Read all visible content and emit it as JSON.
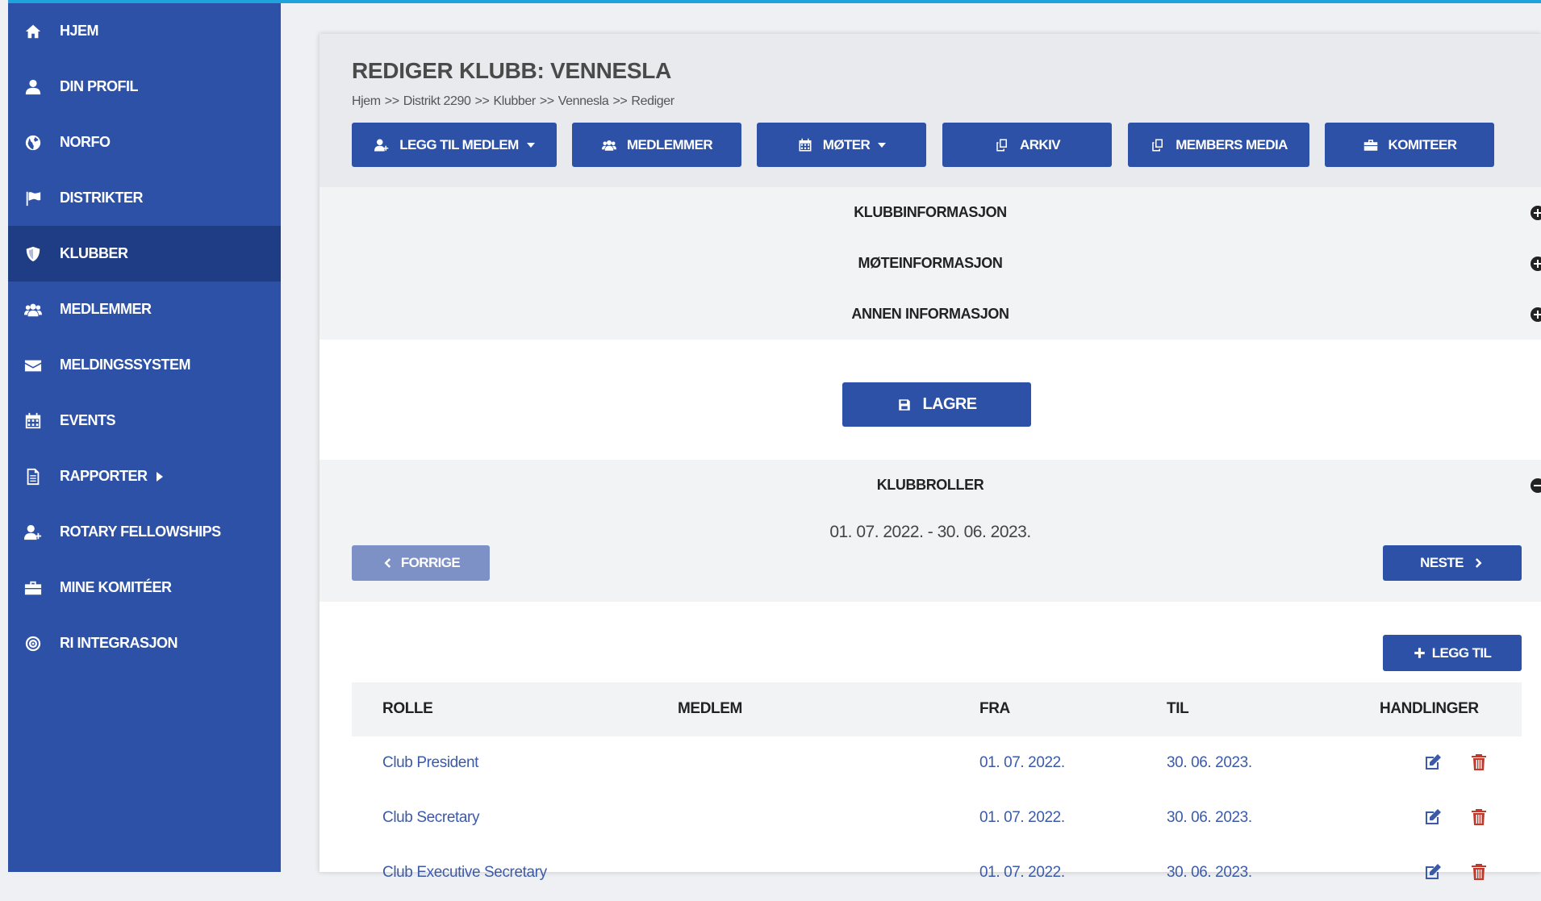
{
  "sidebar": {
    "items": [
      {
        "label": "HJEM",
        "icon": "home-icon"
      },
      {
        "label": "DIN PROFIL",
        "icon": "user-icon"
      },
      {
        "label": "NORFO",
        "icon": "globe-icon"
      },
      {
        "label": "DISTRIKTER",
        "icon": "flag-icon"
      },
      {
        "label": "KLUBBER",
        "icon": "shield-icon",
        "active": true
      },
      {
        "label": "MEDLEMMER",
        "icon": "users-icon"
      },
      {
        "label": "MELDINGSSYSTEM",
        "icon": "envelope-icon"
      },
      {
        "label": "EVENTS",
        "icon": "calendar-icon"
      },
      {
        "label": "RAPPORTER",
        "icon": "document-icon"
      },
      {
        "label": "ROTARY FELLOWSHIPS",
        "icon": "user-plus-icon"
      },
      {
        "label": "MINE KOMITÉER",
        "icon": "briefcase-icon"
      },
      {
        "label": "RI INTEGRASJON",
        "icon": "target-icon"
      }
    ]
  },
  "header": {
    "title": "REDIGER KLUBB: VENNESLA",
    "breadcrumb": [
      "Hjem",
      "Distrikt 2290",
      "Klubber",
      "Vennesla",
      "Rediger"
    ],
    "separator": ">>"
  },
  "toolbar": {
    "add_member": "LEGG TIL MEDLEM",
    "members": "MEDLEMMER",
    "meetings": "MØTER",
    "archive": "ARKIV",
    "members_media": "MEMBERS MEDIA",
    "committees": "KOMITEER"
  },
  "sections": {
    "club_info": "KLUBBINFORMASJON",
    "meeting_info": "MØTEINFORMASJON",
    "other_info": "ANNEN INFORMASJON",
    "club_roles": "KLUBBROLLER"
  },
  "save_label": "LAGRE",
  "roles": {
    "period": "01. 07. 2022. - 30. 06. 2023.",
    "prev_label": "FORRIGE",
    "next_label": "NESTE",
    "add_label": "LEGG TIL",
    "columns": [
      "ROLLE",
      "MEDLEM",
      "FRA",
      "TIL",
      "HANDLINGER"
    ],
    "rows": [
      {
        "role": "Club President",
        "member": "",
        "from": "01. 07. 2022.",
        "to": "30. 06. 2023."
      },
      {
        "role": "Club Secretary",
        "member": "",
        "from": "01. 07. 2022.",
        "to": "30. 06. 2023."
      },
      {
        "role": "Club Executive Secretary",
        "member": "",
        "from": "01. 07. 2022.",
        "to": "30. 06. 2023."
      }
    ]
  },
  "colors": {
    "sidebar_bg": "#2d51a7",
    "sidebar_active": "#1f3d85",
    "accent": "#2d51a7",
    "top_line": "#1fa3dc",
    "link": "#3b5aa8",
    "delete": "#c0392b"
  }
}
